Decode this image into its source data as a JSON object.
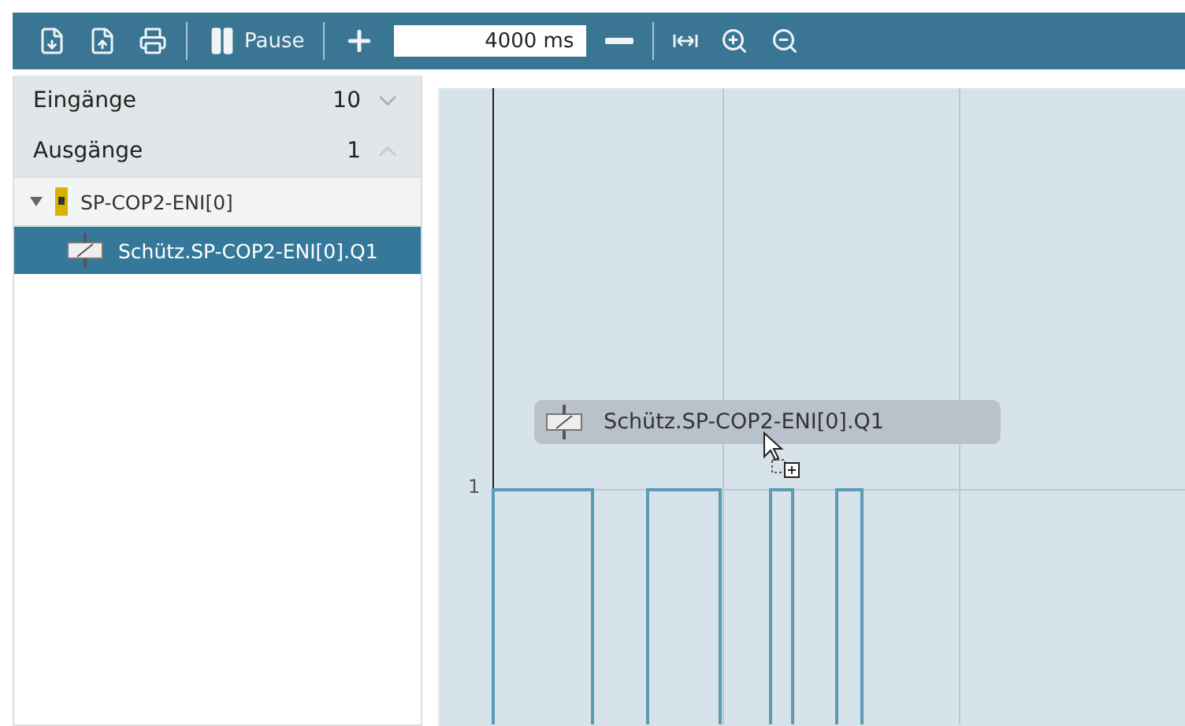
{
  "toolbar": {
    "pause_label": "Pause",
    "interval": "4000 ms"
  },
  "sections": [
    {
      "label": "Eingänge",
      "count": "10",
      "expanded": false
    },
    {
      "label": "Ausgänge",
      "count": "1",
      "expanded": true
    }
  ],
  "tree": [
    {
      "label": "SP-COP2-ENI[0]",
      "expanded": true,
      "selected": false,
      "children": [
        {
          "label": "Schütz.SP-COP2-ENI[0].Q1",
          "selected": true
        }
      ]
    }
  ],
  "chart": {
    "y_tick": "1",
    "drag_label": "Schütz.SP-COP2-ENI[0].Q1"
  }
}
